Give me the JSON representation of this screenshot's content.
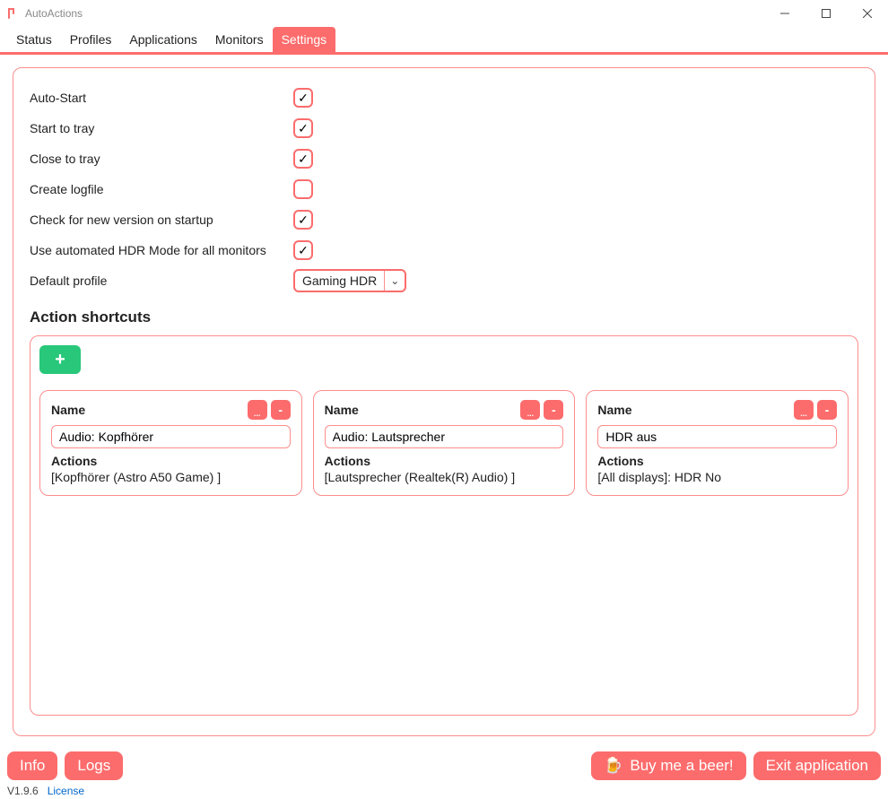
{
  "app": {
    "title": "AutoActions"
  },
  "tabs": {
    "status": "Status",
    "profiles": "Profiles",
    "applications": "Applications",
    "monitors": "Monitors",
    "settings": "Settings"
  },
  "settings": {
    "auto_start": {
      "label": "Auto-Start",
      "checked": true
    },
    "start_to_tray": {
      "label": "Start to tray",
      "checked": true
    },
    "close_to_tray": {
      "label": "Close to tray",
      "checked": true
    },
    "create_logfile": {
      "label": "Create logfile",
      "checked": false
    },
    "check_version": {
      "label": "Check for new version on startup",
      "checked": true
    },
    "auto_hdr": {
      "label": "Use automated HDR Mode for all monitors",
      "checked": true
    },
    "default_profile": {
      "label": "Default profile",
      "value": "Gaming HDR"
    }
  },
  "shortcuts_header": "Action shortcuts",
  "add_icon": "+",
  "cards": [
    {
      "header": "Name",
      "name": "Audio: Kopfhörer",
      "actions_label": "Actions",
      "actions_value": "[Kopfhörer (Astro A50 Game) ]"
    },
    {
      "header": "Name",
      "name": "Audio: Lautsprecher",
      "actions_label": "Actions",
      "actions_value": "[Lautsprecher (Realtek(R) Audio) ]"
    },
    {
      "header": "Name",
      "name": "HDR aus",
      "actions_label": "Actions",
      "actions_value": "[All displays]: HDR No"
    }
  ],
  "card_btn_edit": "...",
  "card_btn_delete": "-",
  "footer": {
    "info": "Info",
    "logs": "Logs",
    "beer": "Buy me a beer!",
    "exit": "Exit application"
  },
  "status": {
    "version": "V1.9.6",
    "license": "License"
  }
}
